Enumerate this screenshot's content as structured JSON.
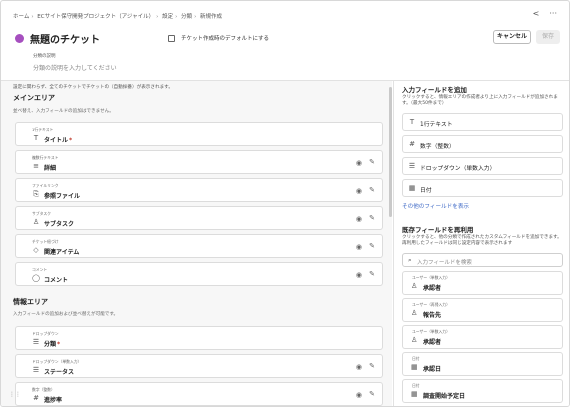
{
  "breadcrumb": [
    "ホーム",
    "ECサイト保守開発プロジェクト（アジャイル）",
    "設定",
    "分類",
    "新規作成"
  ],
  "top_icons": [
    "share-icon",
    "more-icon"
  ],
  "ticket": {
    "title": "無題のチケット",
    "color": "#a64fbf",
    "default_label": "チケット作成時のデフォルトにする",
    "desc_label": "分類の説明",
    "desc_placeholder": "分類の説明を入力してください"
  },
  "buttons": {
    "cancel": "キャンセル",
    "save": "保存"
  },
  "left": {
    "info": "設定に関わらず、全てのチケットでチケットの（自動採番）が表示されます。",
    "main_area": {
      "title": "メインエリア",
      "subtitle": "並べ替え、入力フィールドの追加はできません。",
      "fields": [
        {
          "type": "1行テキスト",
          "name": "タイトル",
          "required": "*",
          "icon": "T"
        },
        {
          "type": "複数行テキスト",
          "name": "詳細",
          "required": "",
          "icon": "≡"
        },
        {
          "type": "ファイルリンク",
          "name": "参照ファイル",
          "required": "",
          "icon": "⎘"
        },
        {
          "type": "サブタスク",
          "name": "サブタスク",
          "required": "",
          "icon": "♙"
        },
        {
          "type": "チケット紐づけ",
          "name": "関連アイテム",
          "required": "",
          "icon": "◇"
        },
        {
          "type": "コメント",
          "name": "コメント",
          "required": "",
          "icon": "◯"
        }
      ]
    },
    "info_area": {
      "title": "情報エリア",
      "subtitle": "入力フィールドの追加および並べ替えが可能です。",
      "fields": [
        {
          "type": "ドロップダウン",
          "name": "分類",
          "required": "*",
          "icon": "☰"
        },
        {
          "type": "ドロップダウン（単数入力）",
          "name": "ステータス",
          "required": "",
          "icon": "☰"
        },
        {
          "type": "数字（整数）",
          "name": "進捗率",
          "required": "",
          "icon": "#"
        }
      ]
    }
  },
  "right": {
    "add_title": "入力フィールドを追加",
    "add_sub": "クリックすると、情報エリアの作成者より上に入力フィールドが追加されます。（最大50件まで）",
    "add_items": [
      {
        "label": "1行テキスト",
        "icon": "T"
      },
      {
        "label": "数字（整数）",
        "icon": "#"
      },
      {
        "label": "ドロップダウン（単数入力）",
        "icon": "☰"
      },
      {
        "label": "日付",
        "icon": "▦"
      }
    ],
    "more_link": "その他のフィールドを表示",
    "reuse_title": "既存フィールドを再利用",
    "reuse_sub": "クリックすると、他の分類で作成されたカスタムフィールドを追加できます。再利用したフィールドは同じ設定内容で表示されます",
    "search_placeholder": "入力フィールドを検索",
    "existing": [
      {
        "type": "ユーザー（単数入力）",
        "name": "承認者",
        "icon": "♙"
      },
      {
        "type": "ユーザー（再帰入力）",
        "name": "報告先",
        "icon": "♙"
      },
      {
        "type": "ユーザー（単数入力）",
        "name": "承認者",
        "icon": "♙"
      },
      {
        "type": "日付",
        "name": "承認日",
        "icon": "▦"
      },
      {
        "type": "日付",
        "name": "調査開始予定日",
        "icon": "▦"
      }
    ]
  }
}
